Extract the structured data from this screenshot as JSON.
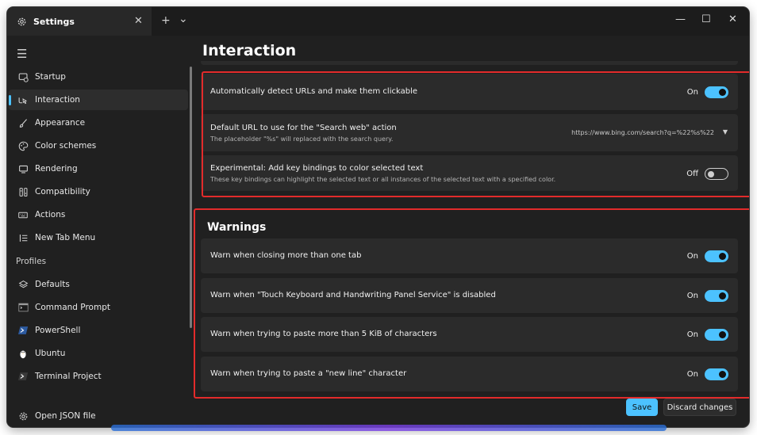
{
  "tab": {
    "title": "Settings",
    "close": "✕",
    "new_tab": "+",
    "dropdown": "⌄"
  },
  "window_controls": {
    "minimize": "—",
    "maximize": "☐",
    "close": "✕"
  },
  "sidebar": {
    "items": [
      {
        "label": "Startup",
        "icon": "startup-icon"
      },
      {
        "label": "Interaction",
        "icon": "interaction-icon",
        "selected": true
      },
      {
        "label": "Appearance",
        "icon": "brush-icon"
      },
      {
        "label": "Color schemes",
        "icon": "palette-icon"
      },
      {
        "label": "Rendering",
        "icon": "monitor-icon"
      },
      {
        "label": "Compatibility",
        "icon": "compatibility-icon"
      },
      {
        "label": "Actions",
        "icon": "keyboard-icon"
      },
      {
        "label": "New Tab Menu",
        "icon": "list-icon"
      }
    ],
    "profiles_header": "Profiles",
    "profiles": [
      {
        "label": "Defaults",
        "icon": "layers-icon"
      },
      {
        "label": "Command Prompt",
        "icon": "cmd-icon"
      },
      {
        "label": "PowerShell",
        "icon": "powershell-icon"
      },
      {
        "label": "Ubuntu",
        "icon": "ubuntu-icon"
      },
      {
        "label": "Terminal Project",
        "icon": "terminal-icon"
      }
    ],
    "open_json": "Open JSON file"
  },
  "main": {
    "title": "Interaction",
    "settings": [
      {
        "title": "Automatically detect URLs and make them clickable",
        "state": "On"
      },
      {
        "title": "Default URL to use for the \"Search web\" action",
        "subtitle": "The placeholder \"%s\" will replaced with the search query.",
        "value": "https://www.bing.com/search?q=%22%s%22"
      },
      {
        "title": "Experimental: Add key bindings to color selected text",
        "subtitle": "These key bindings can highlight the selected text or all instances of the selected text with a specified color.",
        "state": "Off"
      }
    ],
    "warnings_title": "Warnings",
    "warnings": [
      {
        "title": "Warn when closing more than one tab",
        "state": "On"
      },
      {
        "title": "Warn when \"Touch Keyboard and Handwriting Panel Service\" is disabled",
        "state": "On"
      },
      {
        "title": "Warn when trying to paste more than 5 KiB of characters",
        "state": "On"
      },
      {
        "title": "Warn when trying to paste a \"new line\" character",
        "state": "On"
      }
    ]
  },
  "footer": {
    "save": "Save",
    "discard": "Discard changes"
  },
  "colors": {
    "accent": "#4cc2ff",
    "highlight_box": "#e32b2b",
    "background": "#202020",
    "card": "#2b2b2b"
  }
}
